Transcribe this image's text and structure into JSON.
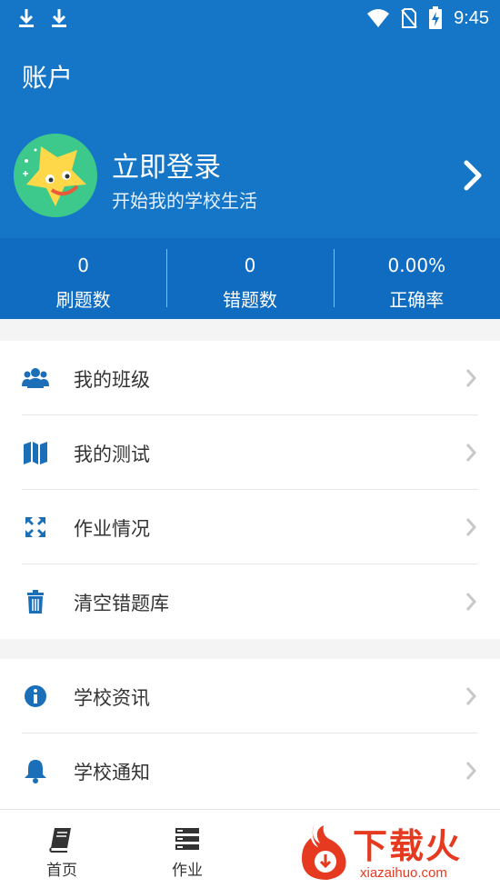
{
  "status_bar": {
    "time": "9:45"
  },
  "header": {
    "title": "账户"
  },
  "profile": {
    "login_title": "立即登录",
    "login_subtitle": "开始我的学校生活"
  },
  "stats": [
    {
      "value": "0",
      "label": "刷题数"
    },
    {
      "value": "0",
      "label": "错题数"
    },
    {
      "value": "0.00%",
      "label": "正确率"
    }
  ],
  "menu_group_1": [
    {
      "label": "我的班级",
      "icon": "users-icon"
    },
    {
      "label": "我的测试",
      "icon": "map-icon"
    },
    {
      "label": "作业情况",
      "icon": "expand-icon"
    },
    {
      "label": "清空错题库",
      "icon": "trash-icon"
    }
  ],
  "menu_group_2": [
    {
      "label": "学校资讯",
      "icon": "info-icon"
    },
    {
      "label": "学校通知",
      "icon": "bell-icon"
    }
  ],
  "tabbar": [
    {
      "label": "首页",
      "icon": "book-icon"
    },
    {
      "label": "作业",
      "icon": "list-icon"
    }
  ],
  "watermark": {
    "text": "下载火",
    "url": "xiazaihuo.com"
  },
  "colors": {
    "primary": "#1576c7",
    "stats_bg": "#0f6cc0",
    "icon_blue": "#1a6fb8",
    "watermark": "#e63a20"
  }
}
